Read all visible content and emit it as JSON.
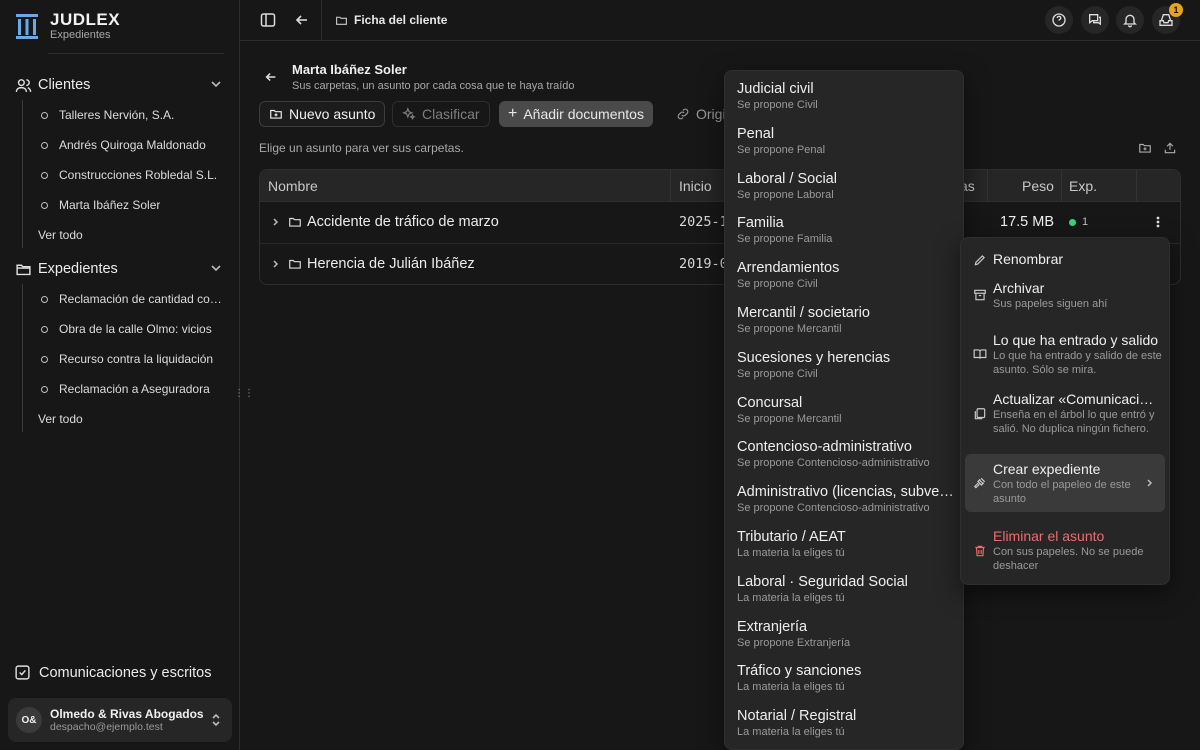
{
  "brand": {
    "name": "JUDLEX",
    "subtitle": "Expedientes"
  },
  "sidebar": {
    "clients": {
      "label": "Clientes",
      "items": [
        "Talleres Nervión, S.A.",
        "Andrés Quiroga Maldonado",
        "Construcciones Robledal S.L.",
        "Marta Ibáñez Soler"
      ],
      "see_all": "Ver todo"
    },
    "files": {
      "label": "Expedientes",
      "items": [
        "Reclamación de cantidad contra",
        "Obra de la calle Olmo: vicios",
        "Recurso contra la liquidación",
        "Reclamación a Aseguradora"
      ],
      "see_all": "Ver todo"
    },
    "comms": "Comunicaciones y escritos",
    "account": {
      "initials": "O&",
      "name": "Olmedo & Rivas Abogados",
      "email": "despacho@ejemplo.test"
    }
  },
  "topbar": {
    "breadcrumb": "Ficha del cliente",
    "notif_count": "1"
  },
  "header": {
    "client_name": "Marta Ibáñez Soler",
    "client_sub": "Sus carpetas, un asunto por cada cosa que te haya traído"
  },
  "toolbar": {
    "new": "Nuevo asunto",
    "classify": "Clasificar",
    "add_docs": "Añadir documentos",
    "origin": "Origi"
  },
  "hint": "Elige un asunto para ver sus carpetas.",
  "table": {
    "headers": {
      "name": "Nombre",
      "start": "Inicio",
      "items": "as",
      "weight": "Peso",
      "exp": "Exp."
    },
    "rows": [
      {
        "name": "Accidente de tráfico de marzo",
        "date": "2025-1",
        "size": "17.5 MB",
        "exp": "1"
      },
      {
        "name": "Herencia de Julián Ibáñez",
        "date": "2019-0",
        "size": "",
        "exp": ""
      }
    ]
  },
  "materias": [
    {
      "label": "Judicial civil",
      "sub": "Se propone Civil"
    },
    {
      "label": "Penal",
      "sub": "Se propone Penal"
    },
    {
      "label": "Laboral / Social",
      "sub": "Se propone Laboral"
    },
    {
      "label": "Familia",
      "sub": "Se propone Familia"
    },
    {
      "label": "Arrendamientos",
      "sub": "Se propone Civil"
    },
    {
      "label": "Mercantil / societario",
      "sub": "Se propone Mercantil"
    },
    {
      "label": "Sucesiones y herencias",
      "sub": "Se propone Civil"
    },
    {
      "label": "Concursal",
      "sub": "Se propone Mercantil"
    },
    {
      "label": "Contencioso-administrativo",
      "sub": "Se propone Contencioso-administrativo"
    },
    {
      "label": "Administrativo (licencias, subvenciones)",
      "sub": "Se propone Contencioso-administrativo"
    },
    {
      "label": "Tributario / AEAT",
      "sub": "La materia la eliges tú"
    },
    {
      "label": "Laboral · Seguridad Social",
      "sub": "La materia la eliges tú"
    },
    {
      "label": "Extranjería",
      "sub": "Se propone Extranjería"
    },
    {
      "label": "Tráfico y sanciones",
      "sub": "La materia la eliges tú"
    },
    {
      "label": "Notarial / Registral",
      "sub": "La materia la eliges tú"
    }
  ],
  "context_menu": {
    "rename": {
      "label": "Renombrar"
    },
    "archive": {
      "label": "Archivar",
      "sub": "Sus papeles siguen ahí"
    },
    "history": {
      "label": "Lo que ha entrado y salido",
      "sub": "Lo que ha entrado y salido de este asunto. Sólo se mira."
    },
    "update": {
      "label": "Actualizar «Comunicaciones»",
      "sub": "Enseña en el árbol lo que entró y salió. No duplica ningún fichero."
    },
    "create": {
      "label": "Crear expediente",
      "sub": "Con todo el papeleo de este asunto"
    },
    "delete": {
      "label": "Eliminar el asunto",
      "sub": "Con sus papeles. No se puede deshacer"
    }
  }
}
